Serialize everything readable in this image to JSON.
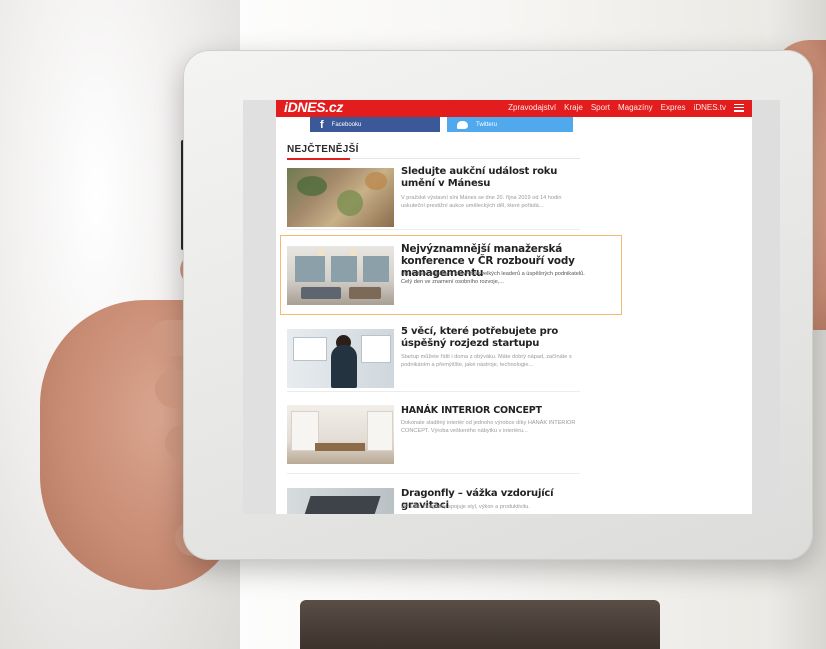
{
  "site": {
    "logo": "iDNES.cz",
    "nav": [
      "Zpravodajství",
      "Kraje",
      "Sport",
      "Magazíny",
      "Expres",
      "iDNES.tv"
    ],
    "accent": "#e31d1d"
  },
  "social": {
    "facebook": "Facebooku",
    "twitter": "Twitteru"
  },
  "section": {
    "title": "NEJČTENĚJŠÍ"
  },
  "articles": [
    {
      "title": "Sledujte aukční událost roku umění v Mánesu",
      "desc": "V pražské výstavní síni Mánes se dne 20. října 2019 od 14 hodin uskuteční prestižní aukce uměleckých děl, které pořádá..."
    },
    {
      "title": "Nejvýznamnější manažerská konference v ČR rozbouří vody managementu",
      "desc": "Inspirativní příběhy a know-how velkých leaderů a úspěšných podnikatelů. Celý den ve znamení osobního rozvoje,..."
    },
    {
      "title": "5 věcí, které potřebujete pro úspěšný rozjezd startupu",
      "desc": "Startup můžete řídit i doma z obýváku. Máte dobrý nápad, začínáte s podnikáním a přemýšlíte, jaké nástroje, technologie..."
    },
    {
      "title": "HANÁK INTERIOR CONCEPT",
      "desc": "Dokonale sladěný interiér od jednoho výrobce díky HANÁK INTERIOR CONCEPT. Výroba veškerého nábytku v interiéru..."
    },
    {
      "title": "Dragonfly – vážka vzdorující gravitaci",
      "desc": "HP Elite Dragonfly spojuje styl, výkon a produktivitu."
    }
  ]
}
